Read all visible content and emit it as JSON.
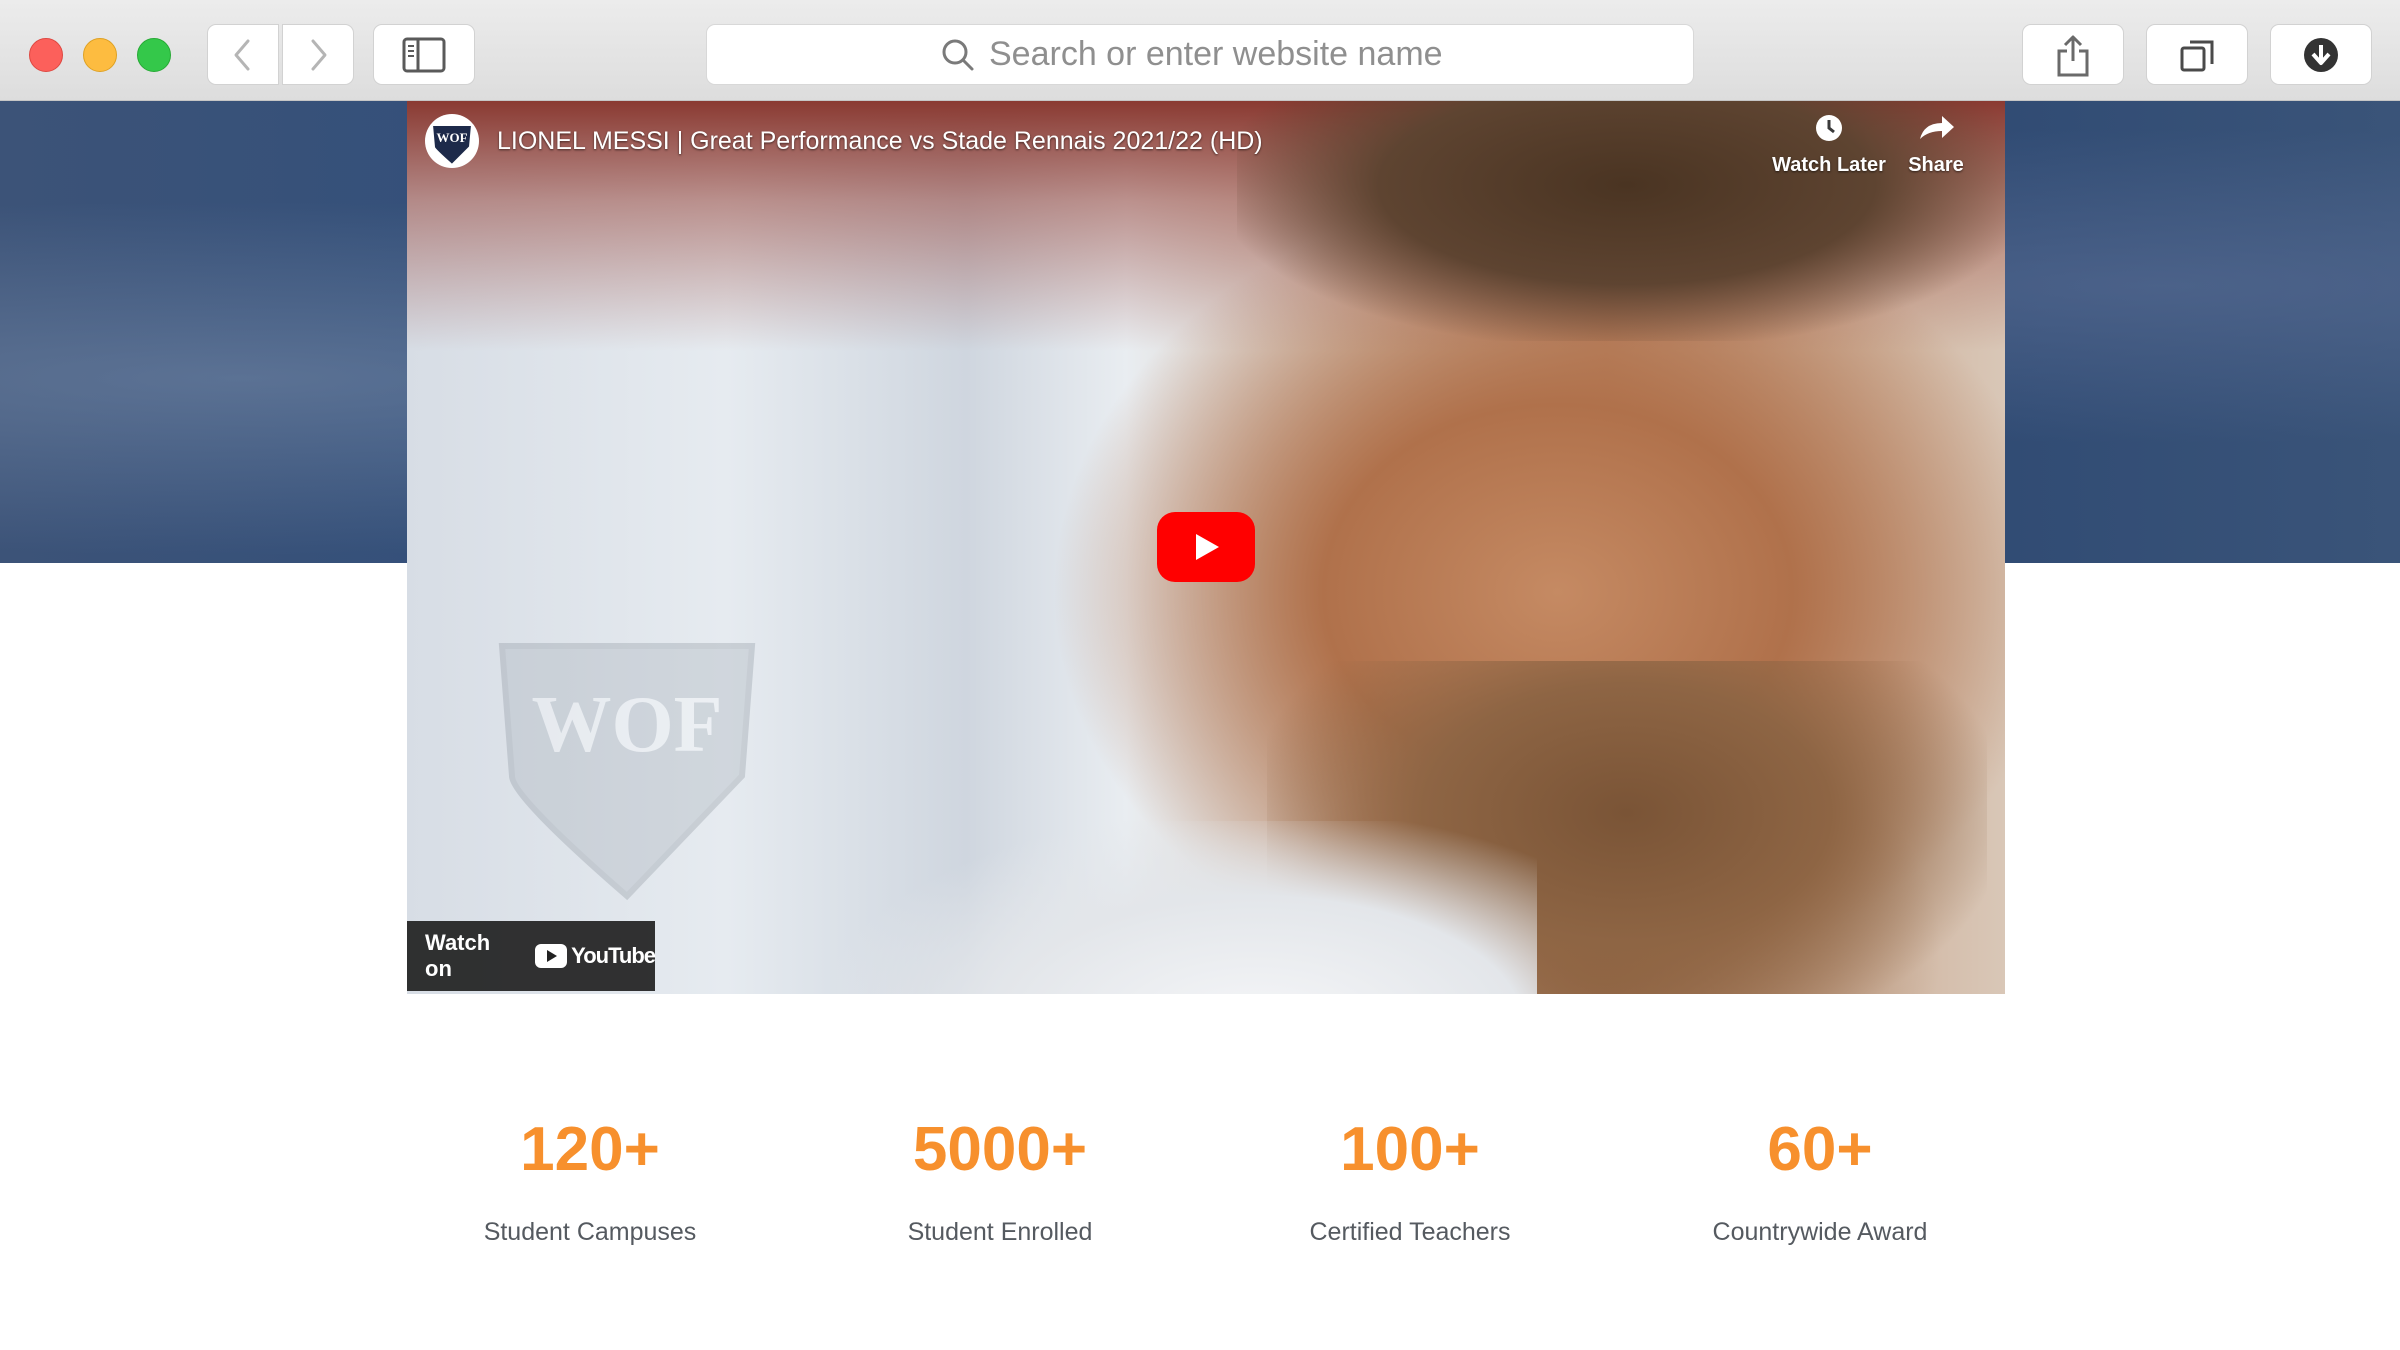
{
  "browser": {
    "address_placeholder": "Search or enter website name"
  },
  "video": {
    "title": "LIONEL MESSI | Great Performance vs Stade Rennais 2021/22 (HD)",
    "channel_logo_text": "WOF",
    "watch_later_label": "Watch Later",
    "share_label": "Share",
    "watch_on_label": "Watch on",
    "youtube_wordmark": "YouTube",
    "watermark_text": "WOF"
  },
  "stats": [
    {
      "number": "120+",
      "label": "Student Campuses"
    },
    {
      "number": "5000+",
      "label": "Student Enrolled"
    },
    {
      "number": "100+",
      "label": "Certified Teachers"
    },
    {
      "number": "60+",
      "label": "Countrywide Award"
    }
  ],
  "colors": {
    "accent": "#f7902d",
    "youtube_red": "#ff0000",
    "hero_band": "#2f4a73"
  }
}
